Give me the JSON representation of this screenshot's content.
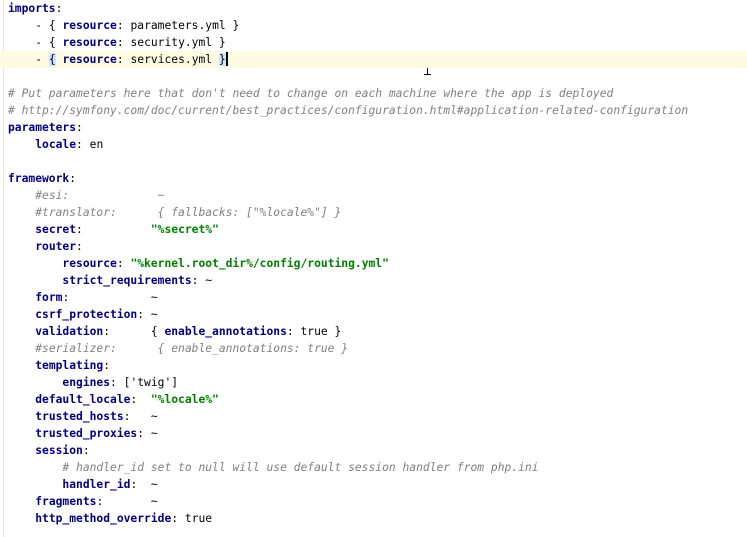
{
  "lines": [
    {
      "indent": "",
      "key": "imports",
      "sep": ":",
      "val": "",
      "val_type": "plain"
    },
    {
      "indent": "    ",
      "prefix": "- { ",
      "key": "resource",
      "sep": ": ",
      "val": "parameters.yml",
      "suffix": " }",
      "val_type": "plain"
    },
    {
      "indent": "    ",
      "prefix": "- { ",
      "key": "resource",
      "sep": ": ",
      "val": "security.yml",
      "suffix": " }",
      "val_type": "plain"
    },
    {
      "indent": "    ",
      "prefix": "- ",
      "brace_open": "{",
      "mid": " ",
      "key": "resource",
      "sep": ": ",
      "val": "services.yml",
      "brace_close": "}",
      "val_type": "plain",
      "current": true
    },
    {
      "blank": true
    },
    {
      "comment": "# Put parameters here that don't need to change on each machine where the app is deployed"
    },
    {
      "comment": "# http://symfony.com/doc/current/best_practices/configuration.html#application-related-configuration"
    },
    {
      "indent": "",
      "key": "parameters",
      "sep": ":",
      "val": "",
      "val_type": "plain"
    },
    {
      "indent": "    ",
      "key": "locale",
      "sep": ": ",
      "val": "en",
      "val_type": "plain"
    },
    {
      "blank": true
    },
    {
      "indent": "",
      "key": "framework",
      "sep": ":",
      "val": "",
      "val_type": "plain"
    },
    {
      "indent": "    ",
      "comment": "#esi:             ~"
    },
    {
      "indent": "    ",
      "comment": "#translator:      { fallbacks: [\"%locale%\"] }"
    },
    {
      "indent": "    ",
      "key": "secret",
      "sep": ":          ",
      "val": "\"%secret%\"",
      "val_type": "string"
    },
    {
      "indent": "    ",
      "key": "router",
      "sep": ":",
      "val": "",
      "val_type": "plain"
    },
    {
      "indent": "        ",
      "key": "resource",
      "sep": ": ",
      "val": "\"%kernel.root_dir%/config/routing.yml\"",
      "val_type": "string"
    },
    {
      "indent": "        ",
      "key": "strict_requirements",
      "sep": ": ",
      "val": "~",
      "val_type": "plain"
    },
    {
      "indent": "    ",
      "key": "form",
      "sep": ":            ",
      "val": "~",
      "val_type": "plain"
    },
    {
      "indent": "    ",
      "key": "csrf_protection",
      "sep": ": ",
      "val": "~",
      "val_type": "plain"
    },
    {
      "indent": "    ",
      "key": "validation",
      "sep": ":      ",
      "val": "{ ",
      "key2": "enable_annotations",
      "sep2": ": ",
      "val2": "true }",
      "val_type": "plain"
    },
    {
      "indent": "    ",
      "comment": "#serializer:      { enable_annotations: true }"
    },
    {
      "indent": "    ",
      "key": "templating",
      "sep": ":",
      "val": "",
      "val_type": "plain"
    },
    {
      "indent": "        ",
      "key": "engines",
      "sep": ": ",
      "val": "['twig']",
      "val_type": "plain"
    },
    {
      "indent": "    ",
      "key": "default_locale",
      "sep": ":  ",
      "val": "\"%locale%\"",
      "val_type": "string"
    },
    {
      "indent": "    ",
      "key": "trusted_hosts",
      "sep": ":   ",
      "val": "~",
      "val_type": "plain"
    },
    {
      "indent": "    ",
      "key": "trusted_proxies",
      "sep": ": ",
      "val": "~",
      "val_type": "plain"
    },
    {
      "indent": "    ",
      "key": "session",
      "sep": ":",
      "val": "",
      "val_type": "plain"
    },
    {
      "indent": "        ",
      "comment": "# handler_id set to null will use default session handler from php.ini"
    },
    {
      "indent": "        ",
      "key": "handler_id",
      "sep": ":  ",
      "val": "~",
      "val_type": "plain"
    },
    {
      "indent": "    ",
      "key": "fragments",
      "sep": ":       ",
      "val": "~",
      "val_type": "plain"
    },
    {
      "indent": "    ",
      "key": "http_method_override",
      "sep": ": ",
      "val": "true",
      "val_type": "plain"
    }
  ]
}
